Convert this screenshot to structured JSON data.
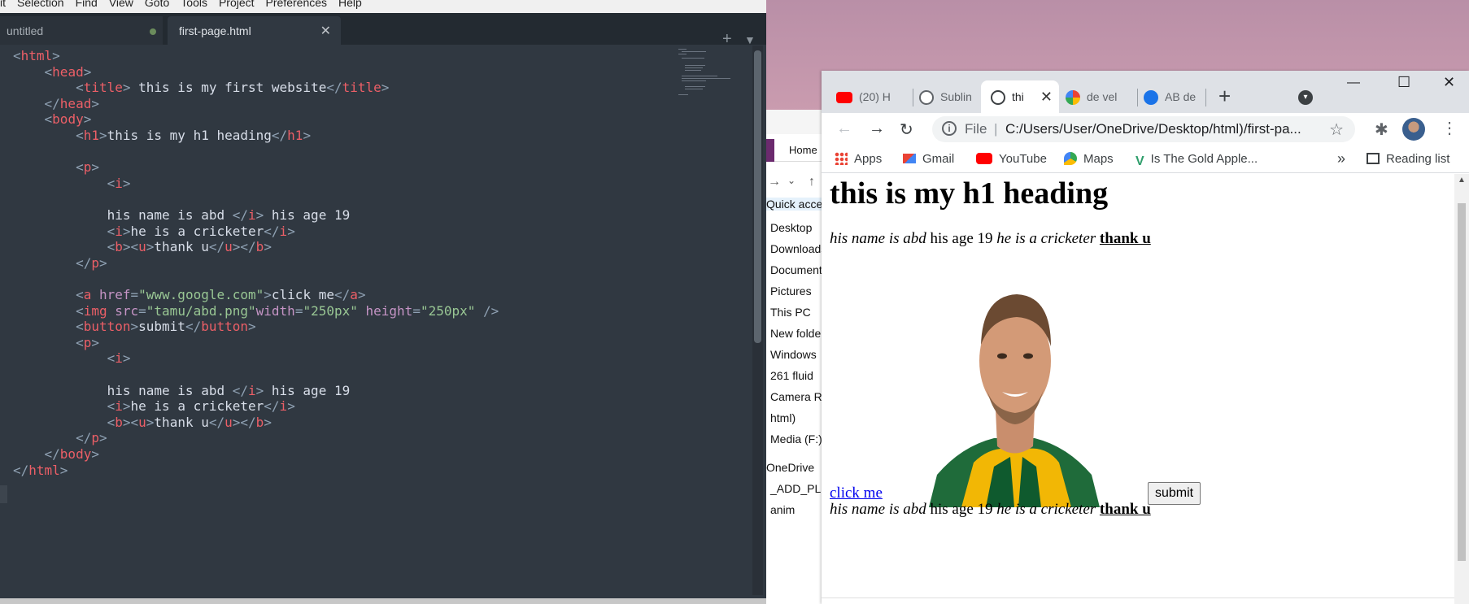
{
  "sublime": {
    "menu": [
      "it",
      "Selection",
      "Find",
      "View",
      "Goto",
      "Tools",
      "Project",
      "Preferences",
      "Help"
    ],
    "tabs": [
      {
        "label": "untitled"
      },
      {
        "label": "first-page.html"
      }
    ]
  },
  "code_lines": [
    [
      [
        "p",
        "<"
      ],
      [
        "t",
        "html"
      ],
      [
        "p",
        ">"
      ]
    ],
    [
      [
        "x",
        "    "
      ],
      [
        "p",
        "<"
      ],
      [
        "t",
        "head"
      ],
      [
        "p",
        ">"
      ]
    ],
    [
      [
        "x",
        "        "
      ],
      [
        "p",
        "<"
      ],
      [
        "t",
        "title"
      ],
      [
        "p",
        "> "
      ],
      [
        "x",
        "this is my first website"
      ],
      [
        "p",
        "</"
      ],
      [
        "t",
        "title"
      ],
      [
        "p",
        ">"
      ]
    ],
    [
      [
        "x",
        "    "
      ],
      [
        "p",
        "</"
      ],
      [
        "t",
        "head"
      ],
      [
        "p",
        ">"
      ]
    ],
    [
      [
        "x",
        "    "
      ],
      [
        "p",
        "<"
      ],
      [
        "t",
        "body"
      ],
      [
        "p",
        ">"
      ]
    ],
    [
      [
        "x",
        "        "
      ],
      [
        "p",
        "<"
      ],
      [
        "t",
        "h1"
      ],
      [
        "p",
        ">"
      ],
      [
        "x",
        "this is my h1 heading"
      ],
      [
        "p",
        "</"
      ],
      [
        "t",
        "h1"
      ],
      [
        "p",
        ">"
      ]
    ],
    [],
    [
      [
        "x",
        "        "
      ],
      [
        "p",
        "<"
      ],
      [
        "t",
        "p"
      ],
      [
        "p",
        ">"
      ]
    ],
    [
      [
        "x",
        "            "
      ],
      [
        "p",
        "<"
      ],
      [
        "t",
        "i"
      ],
      [
        "p",
        ">"
      ]
    ],
    [],
    [
      [
        "x",
        "            his name is abd "
      ],
      [
        "p",
        "</"
      ],
      [
        "t",
        "i"
      ],
      [
        "p",
        "> "
      ],
      [
        "x",
        "his age 19"
      ]
    ],
    [
      [
        "x",
        "            "
      ],
      [
        "p",
        "<"
      ],
      [
        "t",
        "i"
      ],
      [
        "p",
        ">"
      ],
      [
        "x",
        "he is a cricketer"
      ],
      [
        "p",
        "</"
      ],
      [
        "t",
        "i"
      ],
      [
        "p",
        ">"
      ]
    ],
    [
      [
        "x",
        "            "
      ],
      [
        "p",
        "<"
      ],
      [
        "t",
        "b"
      ],
      [
        "p",
        "><"
      ],
      [
        "t",
        "u"
      ],
      [
        "p",
        ">"
      ],
      [
        "x",
        "thank u"
      ],
      [
        "p",
        "</"
      ],
      [
        "t",
        "u"
      ],
      [
        "p",
        "></"
      ],
      [
        "t",
        "b"
      ],
      [
        "p",
        ">"
      ]
    ],
    [
      [
        "x",
        "        "
      ],
      [
        "p",
        "</"
      ],
      [
        "t",
        "p"
      ],
      [
        "p",
        ">"
      ]
    ],
    [],
    [
      [
        "x",
        "        "
      ],
      [
        "p",
        "<"
      ],
      [
        "t",
        "a "
      ],
      [
        "a",
        "href"
      ],
      [
        "p",
        "="
      ],
      [
        "s",
        "\"www.google.com\""
      ],
      [
        "p",
        ">"
      ],
      [
        "x",
        "click me"
      ],
      [
        "p",
        "</"
      ],
      [
        "t",
        "a"
      ],
      [
        "p",
        ">"
      ]
    ],
    [
      [
        "x",
        "        "
      ],
      [
        "p",
        "<"
      ],
      [
        "t",
        "img "
      ],
      [
        "a",
        "src"
      ],
      [
        "p",
        "="
      ],
      [
        "s",
        "\"tamu/abd.png\""
      ],
      [
        "a",
        "width"
      ],
      [
        "p",
        "="
      ],
      [
        "s",
        "\"250px\" "
      ],
      [
        "a",
        "height"
      ],
      [
        "p",
        "="
      ],
      [
        "s",
        "\"250px\" "
      ],
      [
        "p",
        "/>"
      ]
    ],
    [
      [
        "x",
        "        "
      ],
      [
        "p",
        "<"
      ],
      [
        "t",
        "button"
      ],
      [
        "p",
        ">"
      ],
      [
        "x",
        "submit"
      ],
      [
        "p",
        "</"
      ],
      [
        "t",
        "button"
      ],
      [
        "p",
        ">"
      ]
    ],
    [
      [
        "x",
        "        "
      ],
      [
        "p",
        "<"
      ],
      [
        "t",
        "p"
      ],
      [
        "p",
        ">"
      ]
    ],
    [
      [
        "x",
        "            "
      ],
      [
        "p",
        "<"
      ],
      [
        "t",
        "i"
      ],
      [
        "p",
        ">"
      ]
    ],
    [],
    [
      [
        "x",
        "            his name is abd "
      ],
      [
        "p",
        "</"
      ],
      [
        "t",
        "i"
      ],
      [
        "p",
        "> "
      ],
      [
        "x",
        "his age 19"
      ]
    ],
    [
      [
        "x",
        "            "
      ],
      [
        "p",
        "<"
      ],
      [
        "t",
        "i"
      ],
      [
        "p",
        ">"
      ],
      [
        "x",
        "he is a cricketer"
      ],
      [
        "p",
        "</"
      ],
      [
        "t",
        "i"
      ],
      [
        "p",
        ">"
      ]
    ],
    [
      [
        "x",
        "            "
      ],
      [
        "p",
        "<"
      ],
      [
        "t",
        "b"
      ],
      [
        "p",
        "><"
      ],
      [
        "t",
        "u"
      ],
      [
        "p",
        ">"
      ],
      [
        "x",
        "thank u"
      ],
      [
        "p",
        "</"
      ],
      [
        "t",
        "u"
      ],
      [
        "p",
        "></"
      ],
      [
        "t",
        "b"
      ],
      [
        "p",
        ">"
      ]
    ],
    [
      [
        "x",
        "        "
      ],
      [
        "p",
        "</"
      ],
      [
        "t",
        "p"
      ],
      [
        "p",
        ">"
      ]
    ],
    [
      [
        "x",
        "    "
      ],
      [
        "p",
        "</"
      ],
      [
        "t",
        "body"
      ],
      [
        "p",
        ">"
      ]
    ],
    [
      [
        "p",
        "</"
      ],
      [
        "t",
        "html"
      ],
      [
        "p",
        ">"
      ]
    ]
  ],
  "explorer": {
    "home_tab": "Home",
    "items": [
      "Quick access",
      "Desktop",
      "Downloads",
      "Documents",
      "Pictures",
      "This PC",
      "New folder",
      "Windows",
      "261 fluid",
      "Camera R",
      "html)",
      "Media (F:)",
      "OneDrive",
      "_ADD_PLU",
      "anim"
    ]
  },
  "chrome": {
    "tabs": [
      {
        "label": "(20) H",
        "icon": "youtube-icon"
      },
      {
        "label": "Sublin",
        "icon": "globe-icon"
      },
      {
        "label": "thi",
        "icon": "globe-icon"
      },
      {
        "label": "de vel",
        "icon": "google-icon"
      },
      {
        "label": "AB de",
        "icon": "globe-icon"
      }
    ],
    "omnibox": {
      "scheme": "File",
      "url": "C:/Users/User/OneDrive/Desktop/html)/first-pa..."
    },
    "bookmarks": [
      "Apps",
      "Gmail",
      "YouTube",
      "Maps",
      "Is The Gold Apple..."
    ],
    "reading_list": "Reading list"
  },
  "page": {
    "h1": "this is my h1 heading",
    "para_italic": "his name is abd",
    "para_age": " his age 19 ",
    "para_cricketer": "he is a cricketer",
    "para_thanks": "thank u",
    "link": "click me",
    "button": "submit"
  },
  "colors": {
    "editor_bg": "#303841",
    "tag": "#ec5f67",
    "punct": "#8fa1b3",
    "attr": "#c594c5",
    "string": "#99c794",
    "link": "#0000ee"
  }
}
